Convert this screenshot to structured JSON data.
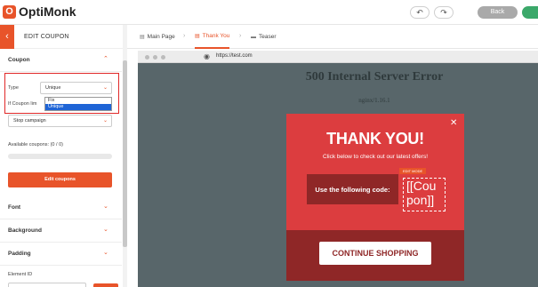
{
  "app": {
    "logo_text": "OptiMonk",
    "logo_letter": "O"
  },
  "topbar": {
    "back_label": "Back",
    "undo_icon": "undo-icon",
    "redo_icon": "redo-icon"
  },
  "sidebar": {
    "back_icon": "chevron-left-icon",
    "title": "EDIT COUPON",
    "coupon_section": "Coupon",
    "type_label": "Type",
    "type_value": "Unique",
    "type_options": [
      "Fix",
      "Unique"
    ],
    "limit_label": "If Coupon lim",
    "limit_value": "Stop campaign",
    "available_label": "Available coupons: (0 / 0)",
    "edit_button": "Edit coupons",
    "sections": [
      "Font",
      "Background",
      "Padding"
    ],
    "element_id_label": "Element ID"
  },
  "tabs": [
    {
      "label": "Main Page",
      "icon": "page-icon"
    },
    {
      "label": "Thank You",
      "icon": "page-icon"
    },
    {
      "label": "Teaser",
      "icon": "teaser-icon"
    }
  ],
  "browser": {
    "url": "https://test.com",
    "error_title": "500 Internal Server Error",
    "error_sub": "nginx/1.16.1"
  },
  "popup": {
    "title": "THANK YOU!",
    "subtitle": "Click below to check out our latest offers!",
    "code_label": "Use the following code:",
    "edit_mode_badge": "EDIT MODE",
    "coupon_line1": "[[Cou",
    "coupon_line2": "pon]]",
    "button_label": "CONTINUE SHOPPING",
    "close_icon": "close-icon"
  },
  "colors": {
    "accent": "#e8542a",
    "popup_red": "#dc3d3f",
    "popup_dark": "#8f2727",
    "bg": "#58666a"
  }
}
